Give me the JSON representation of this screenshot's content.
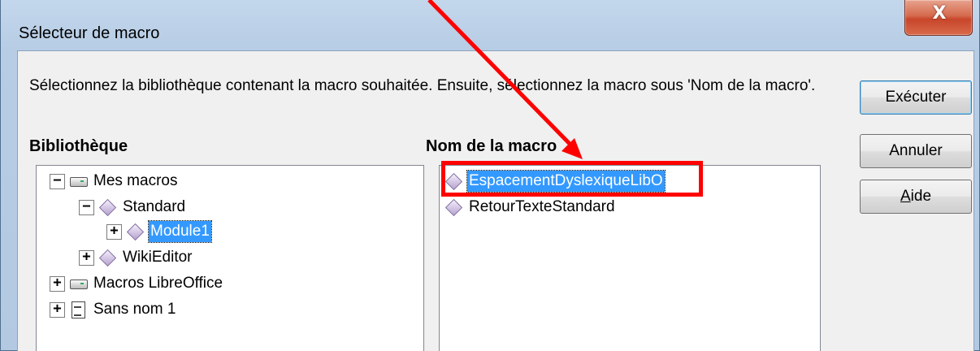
{
  "window": {
    "title": "Sélecteur de macro",
    "close_glyph": "X"
  },
  "instruction": "Sélectionnez la bibliothèque contenant la macro souhaitée. Ensuite, sélectionnez la macro sous 'Nom de la macro'.",
  "library": {
    "header": "Bibliothèque",
    "items": [
      {
        "label": "Mes macros",
        "expander": "−",
        "icon": "drive-icon"
      },
      {
        "label": "Standard",
        "expander": "−",
        "icon": "library-icon"
      },
      {
        "label": "Module1",
        "expander": "+",
        "icon": "module-icon",
        "selected": true
      },
      {
        "label": "WikiEditor",
        "expander": "+",
        "icon": "library-icon"
      },
      {
        "label": "Macros LibreOffice",
        "expander": "+",
        "icon": "drive-icon"
      },
      {
        "label": "Sans nom 1",
        "expander": "+",
        "icon": "document-icon"
      }
    ]
  },
  "macro_names": {
    "header": "Nom de la macro",
    "items": [
      {
        "label": "EspacementDyslexiqueLibO",
        "icon": "macro-icon",
        "selected": true
      },
      {
        "label": "RetourTexteStandard",
        "icon": "macro-icon"
      }
    ]
  },
  "buttons": {
    "run": "Exécuter",
    "cancel": "Annuler",
    "help_prefix": "A",
    "help_rest": "ide"
  },
  "annotation": {
    "color": "#ff0000"
  }
}
